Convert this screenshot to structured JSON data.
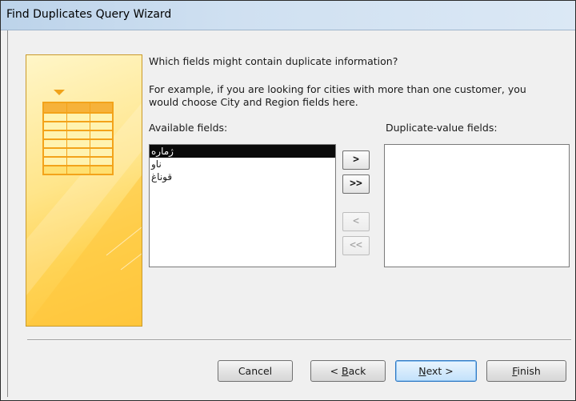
{
  "window": {
    "title": "Find Duplicates Query Wizard"
  },
  "instructions": {
    "question": "Which fields might contain duplicate information?",
    "example_line1": "For example, if you are looking for cities with more than one customer, you",
    "example_line2": "would choose City and Region fields here."
  },
  "available": {
    "label": "Available fields:",
    "items": [
      {
        "label": "ژمارە",
        "selected": true
      },
      {
        "label": "ناو",
        "selected": false
      },
      {
        "label": "قوناغ",
        "selected": false
      }
    ]
  },
  "duplicate": {
    "label": "Duplicate-value fields:",
    "items": []
  },
  "move_buttons": {
    "add_one": ">",
    "add_all": ">>",
    "remove_one": "<",
    "remove_all": "<<"
  },
  "footer": {
    "cancel": "Cancel",
    "back_prefix": "< ",
    "back_mnemonic": "B",
    "back_rest": "ack",
    "next_mnemonic": "N",
    "next_rest": "ext >",
    "finish_mnemonic": "F",
    "finish_rest": "inish"
  },
  "colors": {
    "art_gold": "#ffd456",
    "selection": "#0a0a0a",
    "default_button_border": "#2f79c4"
  }
}
